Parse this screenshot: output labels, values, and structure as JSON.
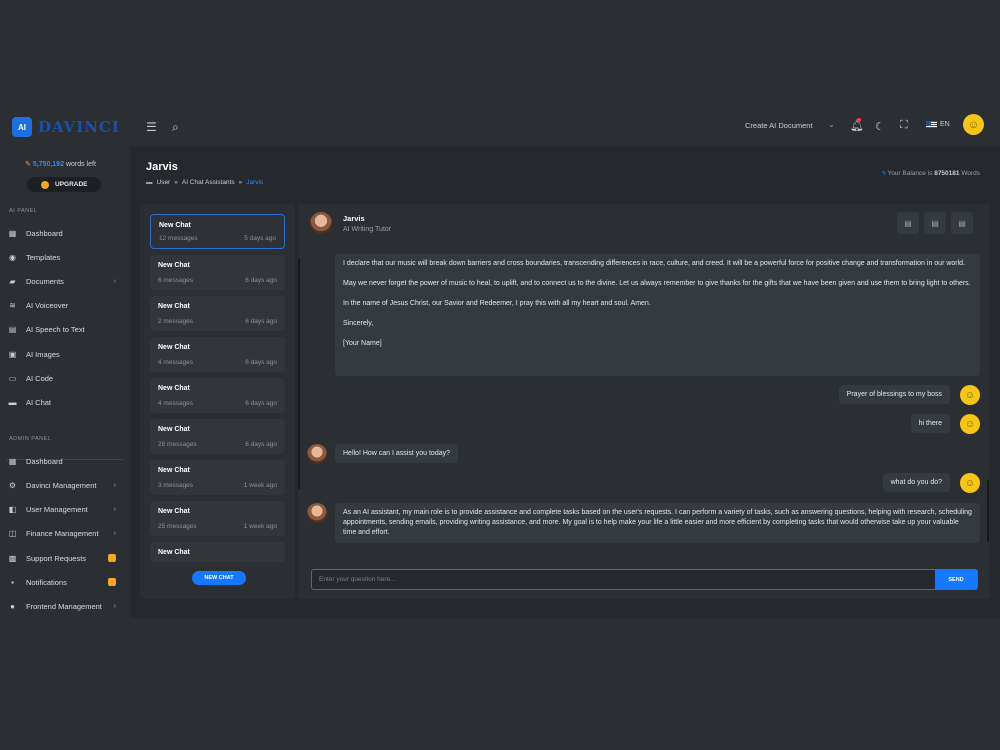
{
  "brand": {
    "logo_chip": "AI",
    "name": "DAVINCI"
  },
  "topbar": {
    "create_document": "Create AI Document",
    "language": "EN"
  },
  "sidebar": {
    "words_count": "5,750,192",
    "words_label": "words left",
    "upgrade_label": "UPGRADE",
    "ai_panel_label": "AI PANEL",
    "ai_items": [
      {
        "label": "Dashboard"
      },
      {
        "label": "Templates"
      },
      {
        "label": "Documents"
      },
      {
        "label": "AI Voiceover"
      },
      {
        "label": "AI Speech to Text"
      },
      {
        "label": "AI Images"
      },
      {
        "label": "AI Code"
      },
      {
        "label": "AI Chat"
      }
    ],
    "admin_panel_label": "ADMIN PANEL",
    "admin_items": [
      {
        "label": "Dashboard"
      },
      {
        "label": "Davinci Management"
      },
      {
        "label": "User Management"
      },
      {
        "label": "Finance Management"
      },
      {
        "label": "Support Requests"
      },
      {
        "label": "Notifications"
      },
      {
        "label": "Frontend Management"
      }
    ]
  },
  "page": {
    "title": "Jarvis",
    "breadcrumb": [
      "User",
      "AI Chat Assistants",
      "Jarvis"
    ],
    "balance_prefix": "Your Balance is",
    "balance_value": "8750181",
    "balance_suffix": "Words"
  },
  "chat_list": [
    {
      "title": "New Chat",
      "messages": "12 messages",
      "date": "5 days ago"
    },
    {
      "title": "New Chat",
      "messages": "6 messages",
      "date": "6 days ago"
    },
    {
      "title": "New Chat",
      "messages": "2 messages",
      "date": "6 days ago"
    },
    {
      "title": "New Chat",
      "messages": "4 messages",
      "date": "6 days ago"
    },
    {
      "title": "New Chat",
      "messages": "4 messages",
      "date": "6 days ago"
    },
    {
      "title": "New Chat",
      "messages": "28 messages",
      "date": "6 days ago"
    },
    {
      "title": "New Chat",
      "messages": "3 messages",
      "date": "1 week ago"
    },
    {
      "title": "New Chat",
      "messages": "25 messages",
      "date": "1 week ago"
    },
    {
      "title": "New Chat",
      "messages": "",
      "date": ""
    }
  ],
  "new_chat_label": "NEW CHAT",
  "assistant": {
    "name": "Jarvis",
    "role": "AI Writing Tutor"
  },
  "messages": {
    "long_bot": [
      "I declare that our music will break down barriers and cross boundaries, transcending differences in race, culture, and creed. It will be a powerful force for positive change and transformation in our world.",
      "May we never forget the power of music to heal, to uplift, and to connect us to the divine. Let us always remember to give thanks for the gifts that we have been given and use them to bring light to others.",
      "In the name of Jesus Christ, our Savior and Redeemer, I pray this with all my heart and soul. Amen.",
      "Sincerely,",
      "[Your Name]"
    ],
    "user1": "Prayer of blessings to my boss",
    "user2": "hi there",
    "bot1": "Hello! How can I assist you today?",
    "user3": "what do you do?",
    "bot2": "As an AI assistant, my main role is to provide assistance and complete tasks based on the user's requests. I can perform a variety of tasks, such as answering questions, helping with research, scheduling appointments, sending emails, providing writing assistance, and more. My goal is to help make your life a little easier and more efficient by completing tasks that would otherwise take up your valuable time and effort."
  },
  "input": {
    "placeholder": "Enter your question here...",
    "send_label": "SEND"
  },
  "colors": {
    "accent": "#1677ff",
    "background": "#25282d",
    "panel": "#2b2e33",
    "bubble": "#353940"
  }
}
